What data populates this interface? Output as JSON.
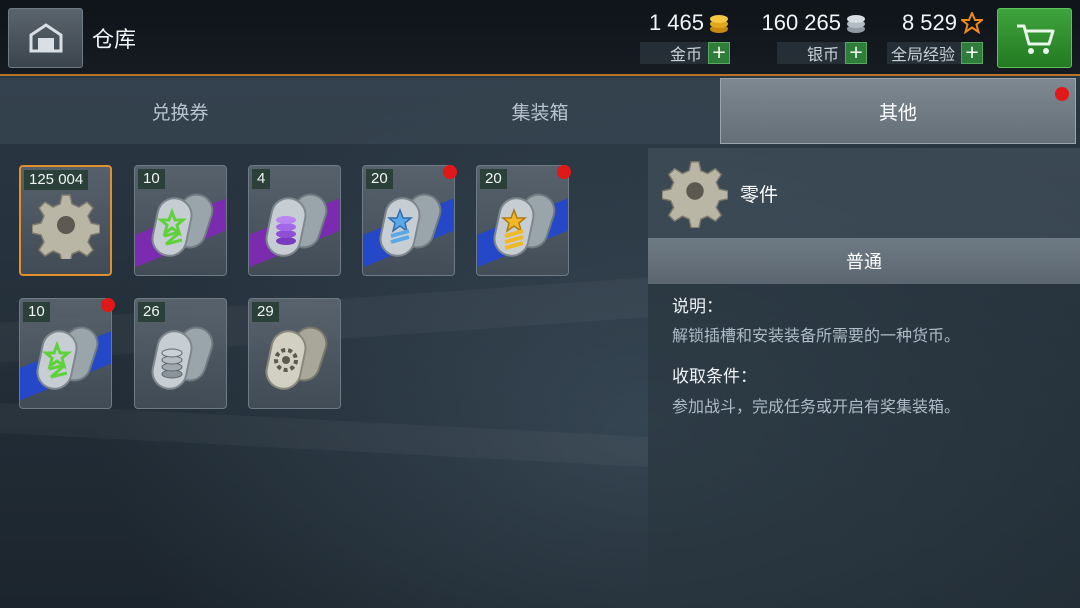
{
  "header": {
    "title": "仓库",
    "currencies": [
      {
        "amount": "1 465",
        "label": "金币",
        "icon": "gold-coins-icon",
        "add": "+"
      },
      {
        "amount": "160 265",
        "label": "银币",
        "icon": "silver-coins-icon",
        "add": "+"
      },
      {
        "amount": "8 529",
        "label": "全局经验",
        "icon": "star-icon",
        "add": "+"
      }
    ]
  },
  "tabs": [
    {
      "label": "兑换券",
      "active": false
    },
    {
      "label": "集装箱",
      "active": false
    },
    {
      "label": "其他",
      "active": true,
      "notification": true
    }
  ],
  "items": [
    {
      "count": "125 004",
      "icon": "gear-parts-icon",
      "band": "none",
      "selected": true,
      "notification": false
    },
    {
      "count": "10",
      "icon": "dogtag-green-star-icon",
      "band": "purple",
      "selected": false,
      "notification": false
    },
    {
      "count": "4",
      "icon": "dogtag-coins-purple-icon",
      "band": "purple",
      "selected": false,
      "notification": false
    },
    {
      "count": "20",
      "icon": "dogtag-blue-star-icon",
      "band": "blue",
      "selected": false,
      "notification": true
    },
    {
      "count": "20",
      "icon": "dogtag-gold-star-icon",
      "band": "blue",
      "selected": false,
      "notification": true
    },
    {
      "count": "10",
      "icon": "dogtag-green-star-icon",
      "band": "blue",
      "selected": false,
      "notification": true
    },
    {
      "count": "26",
      "icon": "dogtag-silver-coins-icon",
      "band": "none",
      "selected": false,
      "notification": false
    },
    {
      "count": "29",
      "icon": "dogtag-gear-icon",
      "band": "none",
      "selected": false,
      "notification": false
    }
  ],
  "detail": {
    "name": "零件",
    "icon": "gear-parts-icon",
    "rarity": "普通",
    "description_title": "说明：",
    "description": "解锁插槽和安装装备所需要的一种货币。",
    "acquire_title": "收取条件：",
    "acquire": "参加战斗，完成任务或开启有奖集装箱。"
  },
  "colors": {
    "accent_orange": "#e0902c",
    "band_purple": "#7a2bb0",
    "band_blue": "#2448c8",
    "plus_green": "#2e7d3a",
    "notification_red": "#e01818"
  }
}
